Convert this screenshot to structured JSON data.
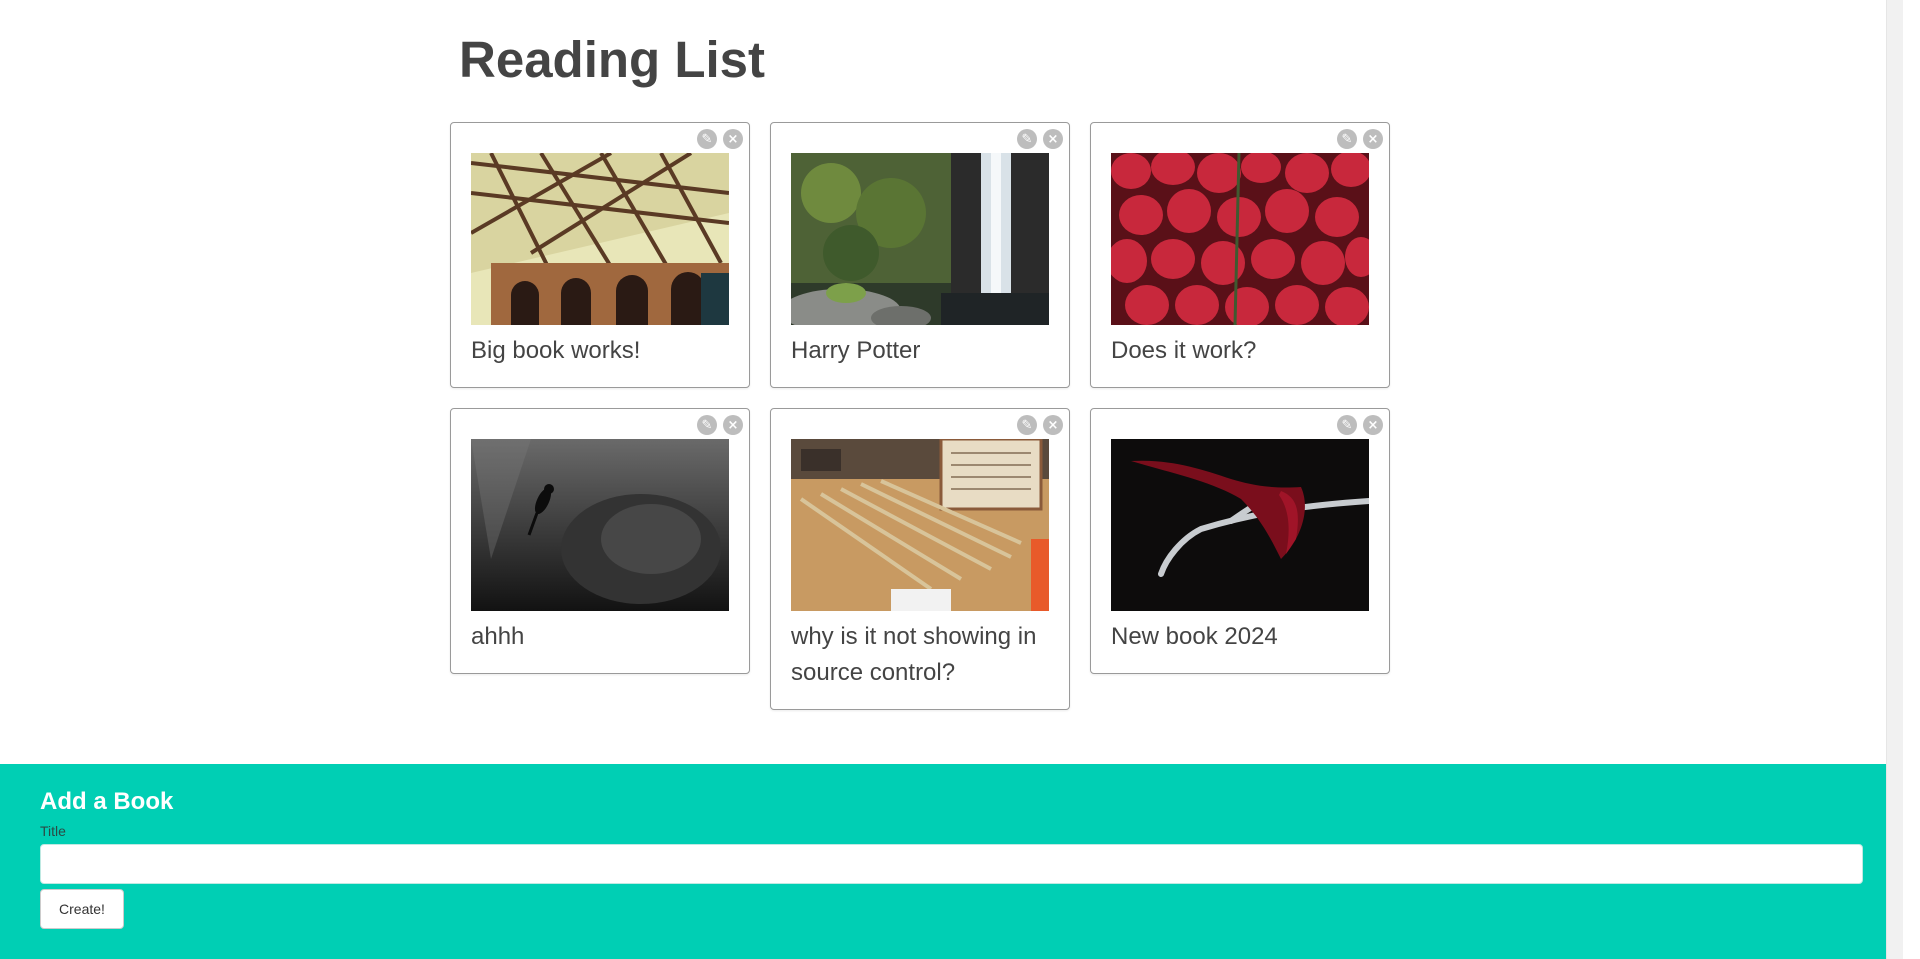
{
  "page": {
    "title": "Reading List"
  },
  "books": [
    {
      "title": "Big book works!",
      "image": "bridge-photo"
    },
    {
      "title": "Harry Potter",
      "image": "waterfall-photo"
    },
    {
      "title": "Does it work?",
      "image": "strawberries-photo"
    },
    {
      "title": "ahhh",
      "image": "scuba-diver-photo"
    },
    {
      "title": "why is it not showing in source control?",
      "image": "measuring-tools-photo"
    },
    {
      "title": "New book 2024",
      "image": "antler-ribbon-photo"
    }
  ],
  "icons": {
    "edit": "pencil-icon",
    "delete": "close-icon"
  },
  "add_form": {
    "heading": "Add a Book",
    "title_label": "Title",
    "title_value": "",
    "submit_label": "Create!"
  },
  "colors": {
    "accent": "#00cfb4",
    "text": "#444444",
    "action_icon": "#bdbdbd"
  }
}
